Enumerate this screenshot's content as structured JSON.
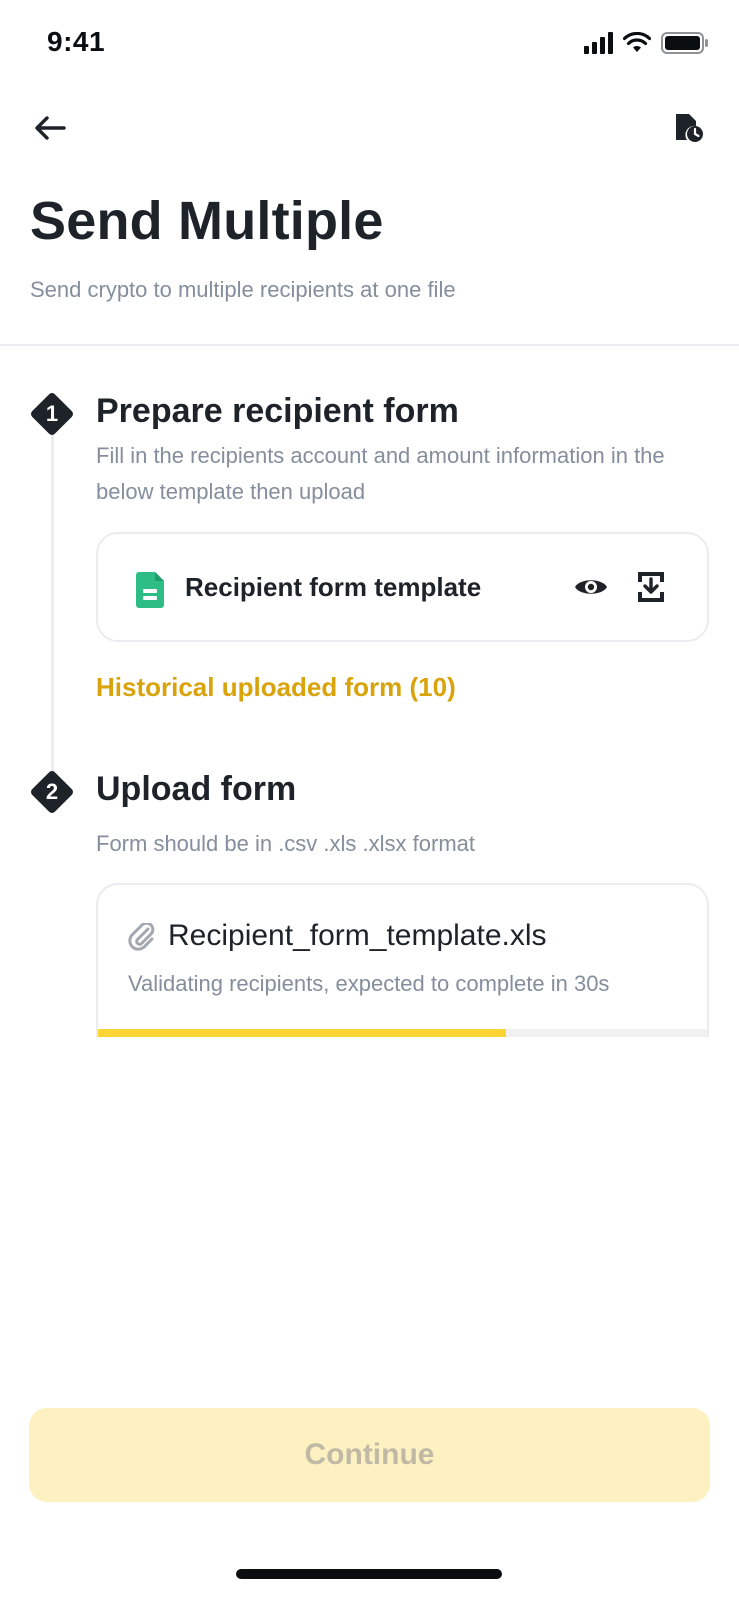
{
  "status_bar": {
    "time": "9:41"
  },
  "header": {
    "back_icon": "arrow-left-icon",
    "history_icon": "document-clock-icon"
  },
  "page": {
    "title": "Send Multiple",
    "subtitle": "Send crypto to multiple recipients at one file"
  },
  "steps": [
    {
      "number": "1",
      "title": "Prepare recipient form",
      "description": "Fill in the recipients account and amount information in the below template then upload"
    },
    {
      "number": "2",
      "title": "Upload form",
      "description": "Form should be in .csv .xls .xlsx format"
    }
  ],
  "template_card": {
    "label": "Recipient form template",
    "file_icon": "sheet-file-icon",
    "preview_icon": "eye-icon",
    "download_icon": "download-icon"
  },
  "history_link": "Historical uploaded form (10)",
  "upload": {
    "file_name": "Recipient_form_template.xls",
    "status": "Validating recipients, expected to complete in 30s",
    "progress_percent": 67
  },
  "continue_label": "Continue",
  "colors": {
    "accent": "#fcd535",
    "link": "#d9a30b",
    "sheet_green": "#2ebd85",
    "button_disabled_bg": "#fdf1c2",
    "text_primary": "#1e2329",
    "text_secondary": "#848e9c"
  }
}
